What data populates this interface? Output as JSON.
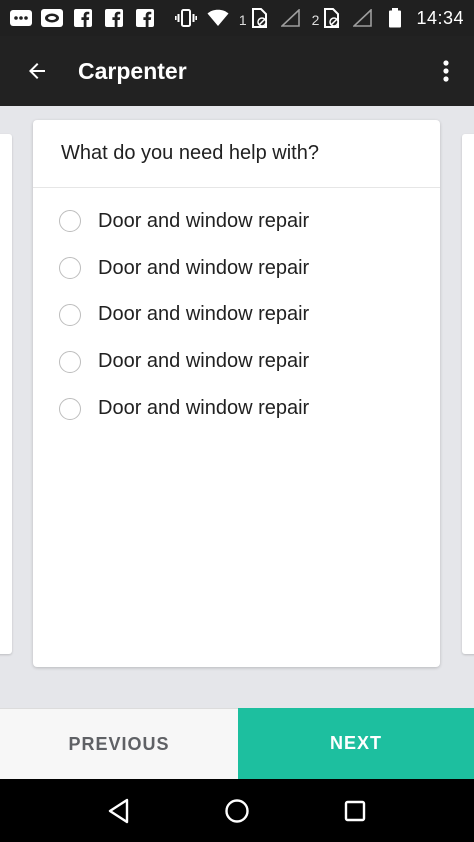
{
  "status_bar": {
    "time": "14:34",
    "sim1": "1",
    "sim2": "2",
    "icons": [
      "messaging-icon",
      "chat-bubble-icon",
      "facebook-icon",
      "facebook-icon",
      "facebook-icon",
      "vibrate-icon",
      "wifi-icon",
      "signal-icon",
      "signal-icon",
      "battery-icon"
    ]
  },
  "app_bar": {
    "title": "Carpenter",
    "back_icon": "arrow-back-icon",
    "menu_icon": "more-vert-icon"
  },
  "card": {
    "question": "What do you need help with?",
    "options": [
      {
        "label": "Door and window repair",
        "selected": false
      },
      {
        "label": "Door and window repair",
        "selected": false
      },
      {
        "label": "Door and window repair",
        "selected": false
      },
      {
        "label": "Door and window repair",
        "selected": false
      },
      {
        "label": "Door and window repair",
        "selected": false
      }
    ]
  },
  "buttons": {
    "previous": "PREVIOUS",
    "next": "NEXT"
  },
  "colors": {
    "accent": "#1dbf9f",
    "app_bar": "#222222",
    "status_bar": "#202020",
    "background": "#e5e6ea"
  }
}
